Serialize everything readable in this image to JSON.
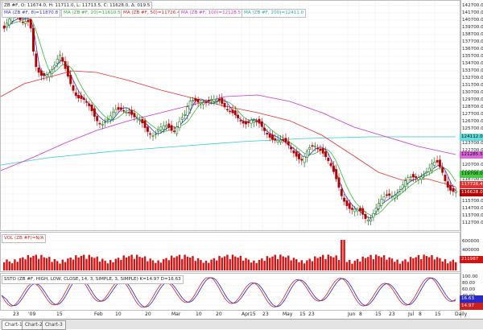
{
  "price_legend": {
    "symbol_info": "ZB #F, O: 11674.0, H: 11711.0, L: 11713.5, C: 11628.0, Δ: 019.5",
    "ma8": "MA (ZB #F, 8)=11870.8",
    "ma20": "MA (ZB #F, 20)=11610.5",
    "ma50": "MA (ZB #F, 50)=11726.4",
    "ma100": "MA (ZB #F, 100)=12128.5",
    "ma200": "MA (ZB #F, 200)=12411.0"
  },
  "volume_legend": "VOL (ZB #F)=N/A",
  "stoch_legend": "SSTO (ZB #F, HIGH, LOW, CLOSE, 14, 3, SIMPLE, 3, SIMPLE)  K=14.97  D=16.63",
  "price_axis": [
    "142700.0",
    "141700.0",
    "140700.0",
    "139700.0",
    "138700.0",
    "137700.0",
    "136700.0",
    "135700.0",
    "134700.0",
    "133700.0",
    "132700.0",
    "131700.0",
    "130700.0",
    "129700.0",
    "128700.0",
    "127700.0",
    "126700.0",
    "125700.0",
    "124700.0",
    "123700.0",
    "122700.0",
    "121700.0",
    "120700.0",
    "119700.0",
    "118700.0",
    "117700.0",
    "116700.0",
    "115700.0",
    "114700.0",
    "113700.0",
    "112700.0"
  ],
  "price_tags": {
    "ma200": "124112.0",
    "ma100": "121285.5",
    "green": "119700.0",
    "ma50": "117726.4",
    "close": "116628.0"
  },
  "volume_axis": [
    "600000",
    "400000",
    "200000"
  ],
  "volume_tag": "211987",
  "stoch_axis": [
    "100.00",
    "80.00",
    "60.00",
    "40.00",
    "20.00"
  ],
  "stoch_tags": [
    "16.63",
    "14.97"
  ],
  "x_axis": [
    "23",
    "'09",
    "15",
    "Feb",
    "10",
    "20",
    "Mar",
    "10",
    "20",
    "Apr",
    "15",
    "23",
    "May",
    "15",
    "23",
    "Jun",
    "8",
    "15",
    "23",
    "Jul",
    "8",
    "15",
    "Daily"
  ],
  "tabs": [
    "Chart-1",
    "Chart-2",
    "Chart-3"
  ],
  "colors": {
    "bull": "#006400",
    "bear": "#b40000",
    "ma8": "#3333cc",
    "ma20": "#33bb33",
    "ma50": "#e03030",
    "ma100": "#cc33cc",
    "ma200": "#33cccc",
    "volume": "#d81010",
    "stoch_k": "#cc2020",
    "stoch_d": "#2020cc"
  }
}
